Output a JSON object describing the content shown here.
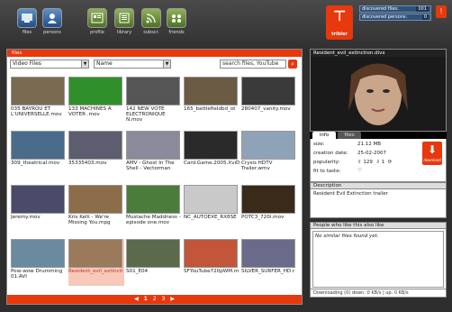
{
  "toolbar": {
    "buttons": [
      {
        "label": "files"
      },
      {
        "label": "persons"
      },
      {
        "label": "profile"
      },
      {
        "label": "library"
      },
      {
        "label": "subscr."
      },
      {
        "label": "friends"
      }
    ]
  },
  "logo": {
    "text": "tribler"
  },
  "stats": {
    "discovered_files_label": "discovered files:",
    "discovered_files_value": "001",
    "discovered_persons_label": "discovered persons:",
    "discovered_persons_value": "0"
  },
  "files_panel": {
    "title": "files",
    "type_filter": "Video Files",
    "sort_filter": "Name",
    "search_value": "search files, YouTube",
    "items": [
      {
        "name": "035 BAYROU ET L'UNIVERSELLE.mov",
        "thumb": "#7a6a52"
      },
      {
        "name": "133 MACHINES A VOTER .mov",
        "thumb": "#2f8f2a"
      },
      {
        "name": "142 NEW VOTE ELECTRONIQUE N.mov",
        "thumb": "#555555"
      },
      {
        "name": "165_battlefieldbd_ot",
        "thumb": "#6b5a44"
      },
      {
        "name": "280407_vanity.mov",
        "thumb": "#3a3a3a"
      },
      {
        "name": "309_theatrical.mov",
        "thumb": "#4b6b8a"
      },
      {
        "name": "35335403.mov",
        "thumb": "#5d5d70"
      },
      {
        "name": "AMV - Ghost In The Shell - Vectorman",
        "thumb": "#8a8a9a"
      },
      {
        "name": "Card.Game.2005.XviD",
        "thumb": "#2a2a2a"
      },
      {
        "name": "Crysis HDTV Trailer.wmv",
        "thumb": "#8fa3b8"
      },
      {
        "name": "Jeremy.mov",
        "thumb": "#4a4a6a"
      },
      {
        "name": "Kris Kelli - We're Missing You.mpg",
        "thumb": "#8c6d4a"
      },
      {
        "name": "Mustache Maddness - episode one.mov",
        "thumb": "#4c7c3c"
      },
      {
        "name": "NC_AUTOEXE_RX8SE",
        "thumb": "#c9c9c9"
      },
      {
        "name": "POTC3_720i.mov",
        "thumb": "#3a2a1a"
      },
      {
        "name": "Pow-wow Drumming 01.AVI",
        "thumb": "#6a8aa0"
      },
      {
        "name": "Resident_evil_extincti",
        "thumb": "#9a7a5a"
      },
      {
        "name": "S01_E04",
        "thumb": "#5a6a4a"
      },
      {
        "name": "SFYouTube720pWM.m",
        "thumb": "#c2553a"
      },
      {
        "name": "SILVER_SURFER_HD.r",
        "thumb": "#6a6a8a"
      }
    ],
    "pager": {
      "prev": "◀",
      "p1": "1",
      "p2": "2",
      "p3": "3",
      "next": "▶"
    }
  },
  "detail": {
    "title": "Resident_evil_extinction.divx",
    "tab_info": "info",
    "tab_files": "files",
    "size_label": "size:",
    "size_value": "21.12 MB",
    "creation_label": "creation date:",
    "creation_value": "25-02-2007",
    "popularity_label": "popularity:",
    "seeders": "129",
    "leechers": "1",
    "fit_label": "fit to taste:",
    "download_label": "download",
    "description_header": "Description",
    "description_text": "Resident Evil Extinction trailer",
    "also_like_header": "People who like this also like",
    "also_like_empty": "No similar files found yet."
  },
  "downloadbar": {
    "text": "Downloading (0)      down: 0 KB/s | up: 0 KB/s"
  }
}
